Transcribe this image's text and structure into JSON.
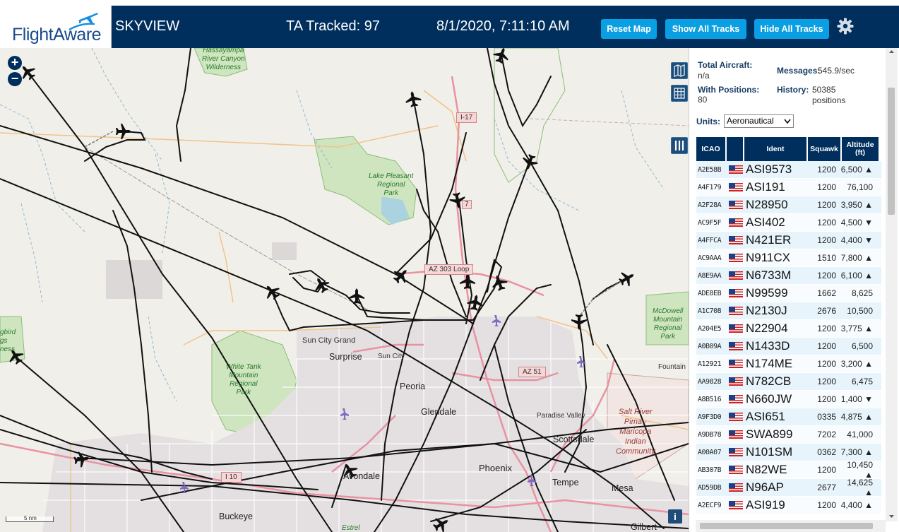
{
  "header": {
    "logo_text": "FlightAware",
    "title": "SKYVIEW",
    "tracked": "TA Tracked: 97",
    "clock": "8/1/2020, 7:11:10 AM",
    "buttons": {
      "reset": "Reset Map",
      "show": "Show All Tracks",
      "hide": "Hide All Tracks"
    },
    "accent": "#002f5d",
    "button_color": "#0a9fe3"
  },
  "map": {
    "zoom_in": "+",
    "zoom_out": "−",
    "scale": "5 nm",
    "info": "i",
    "labels": {
      "hassayampa": "Hassayampa\nRiver Canyon\nWilderness",
      "lake_pleasant": "Lake Pleasant\nRegional\nPark",
      "white_tank": "White Tank\nMountain\nRegional\nPark",
      "mcdowell": "McDowell\nMountain\nRegional\nPark",
      "hassayampa_left": "gbird\ngs\nness",
      "salt_river": "Salt River\nPima -\nMaricopa\nIndian\nCommunity",
      "sun_city_grand": "Sun City Grand",
      "sun_city": "Sun City",
      "surprise": "Surprise",
      "peoria": "Peoria",
      "glendale": "Glendale",
      "paradise_valley": "Paradise Valley",
      "scottsdale": "Scottsdale",
      "phoenix": "Phoenix",
      "tempe": "Tempe",
      "mesa": "Mesa",
      "avondale": "Avondale",
      "buckeye": "Buckeye",
      "gilbert": "Gilbert",
      "fountain": "Fountain",
      "estrella": "Estrel"
    },
    "shields": {
      "i17": "I-17",
      "az303": "AZ 303 Loop",
      "az51": "AZ 51",
      "i10": "I 10",
      "sr74": "7"
    }
  },
  "sidebar": {
    "total_label": "Total Aircraft:",
    "total_value": "n/a",
    "messages_label": "Messages:",
    "messages_value": "545.9/sec",
    "positions_label": "With Positions:",
    "positions_value": "80",
    "history_label": "History:",
    "history_value": "50385\npositions",
    "units_label": "Units:",
    "units_value": "Aeronautical",
    "columns": {
      "icao": "ICAO",
      "ident": "Ident",
      "squawk": "Squawk",
      "altitude": "Altitude\n(ft)"
    },
    "rows": [
      {
        "icao": "A2E58B",
        "ident": "ASI9573",
        "squawk": "1200",
        "alt": "6,500 ▲"
      },
      {
        "icao": "A4F179",
        "ident": "ASI191",
        "squawk": "1200",
        "alt": "76,100"
      },
      {
        "icao": "A2F28A",
        "ident": "N28950",
        "squawk": "1200",
        "alt": "3,950 ▲"
      },
      {
        "icao": "AC9F5F",
        "ident": "ASI402",
        "squawk": "1200",
        "alt": "4,500 ▼"
      },
      {
        "icao": "A4FFCA",
        "ident": "N421ER",
        "squawk": "1200",
        "alt": "4,400 ▼"
      },
      {
        "icao": "AC9AAA",
        "ident": "N911CX",
        "squawk": "1510",
        "alt": "7,800 ▲"
      },
      {
        "icao": "A8E9AA",
        "ident": "N6733M",
        "squawk": "1200",
        "alt": "6,100 ▲"
      },
      {
        "icao": "ADE8EB",
        "ident": "N99599",
        "squawk": "1662",
        "alt": "8,625"
      },
      {
        "icao": "A1C708",
        "ident": "N2130J",
        "squawk": "2676",
        "alt": "10,500"
      },
      {
        "icao": "A204E5",
        "ident": "N22904",
        "squawk": "1200",
        "alt": "3,775 ▲"
      },
      {
        "icao": "A0B09A",
        "ident": "N1433D",
        "squawk": "1200",
        "alt": "6,500"
      },
      {
        "icao": "A12921",
        "ident": "N174ME",
        "squawk": "1200",
        "alt": "3,200 ▲"
      },
      {
        "icao": "AA9828",
        "ident": "N782CB",
        "squawk": "1200",
        "alt": "6,475"
      },
      {
        "icao": "A8B516",
        "ident": "N660JW",
        "squawk": "1200",
        "alt": "1,400 ▼"
      },
      {
        "icao": "A9F3D0",
        "ident": "ASI651",
        "squawk": "0335",
        "alt": "4,875 ▲"
      },
      {
        "icao": "A9DB78",
        "ident": "SWA899",
        "squawk": "7202",
        "alt": "41,000"
      },
      {
        "icao": "A00A07",
        "ident": "N101SM",
        "squawk": "0362",
        "alt": "7,300 ▲"
      },
      {
        "icao": "AB307B",
        "ident": "N82WE",
        "squawk": "1200",
        "alt": "10,450 ▲"
      },
      {
        "icao": "AD59DB",
        "ident": "N96AP",
        "squawk": "2677",
        "alt": "14,625 ▲"
      },
      {
        "icao": "A2ECF9",
        "ident": "ASI919",
        "squawk": "1200",
        "alt": "4,400 ▲"
      }
    ]
  }
}
